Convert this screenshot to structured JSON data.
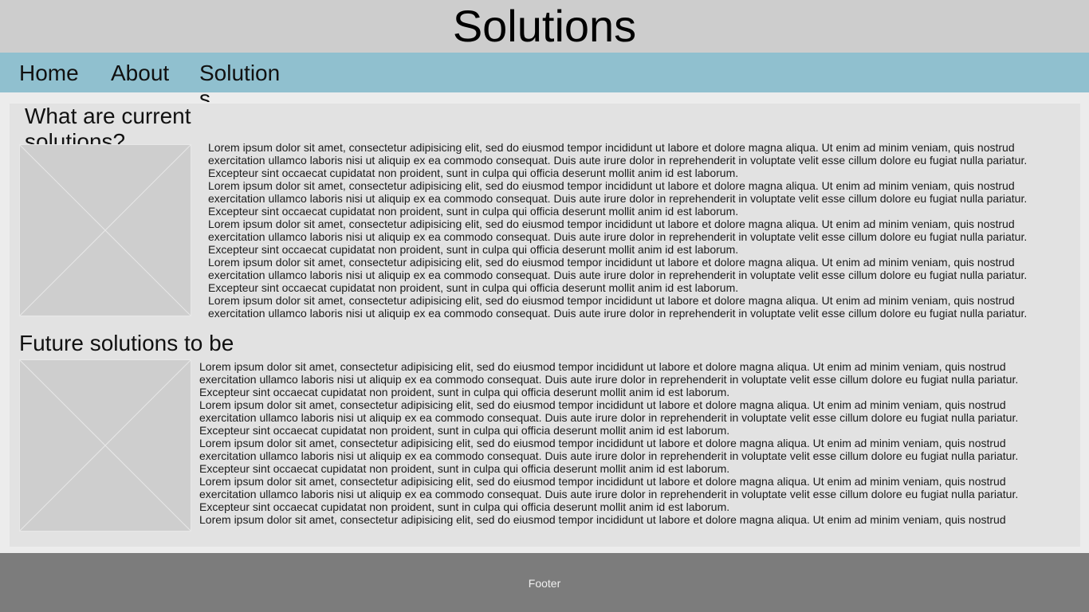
{
  "header": {
    "title": "Solutions"
  },
  "nav": {
    "items": [
      {
        "label": "Home"
      },
      {
        "label": "About"
      },
      {
        "label": "Solutions"
      }
    ]
  },
  "sections": [
    {
      "title": "What are current solutions?",
      "paragraphs": [
        "Lorem ipsum dolor sit amet, consectetur adipisicing elit, sed do eiusmod tempor incididunt ut labore et dolore magna aliqua. Ut enim ad minim veniam, quis nostrud exercitation ullamco laboris nisi ut aliquip ex ea commodo consequat. Duis aute irure dolor in reprehenderit in voluptate velit esse cillum dolore eu fugiat nulla pariatur. Excepteur sint occaecat cupidatat non proident, sunt in culpa qui officia deserunt mollit anim id est laborum.",
        "Lorem ipsum dolor sit amet, consectetur adipisicing elit, sed do eiusmod tempor incididunt ut labore et dolore magna aliqua. Ut enim ad minim veniam, quis nostrud exercitation ullamco laboris nisi ut aliquip ex ea commodo consequat. Duis aute irure dolor in reprehenderit in voluptate velit esse cillum dolore eu fugiat nulla pariatur. Excepteur sint occaecat cupidatat non proident, sunt in culpa qui officia deserunt mollit anim id est laborum.",
        "Lorem ipsum dolor sit amet, consectetur adipisicing elit, sed do eiusmod tempor incididunt ut labore et dolore magna aliqua. Ut enim ad minim veniam, quis nostrud exercitation ullamco laboris nisi ut aliquip ex ea commodo consequat. Duis aute irure dolor in reprehenderit in voluptate velit esse cillum dolore eu fugiat nulla pariatur. Excepteur sint occaecat cupidatat non proident, sunt in culpa qui officia deserunt mollit anim id est laborum.",
        "Lorem ipsum dolor sit amet, consectetur adipisicing elit, sed do eiusmod tempor incididunt ut labore et dolore magna aliqua. Ut enim ad minim veniam, quis nostrud exercitation ullamco laboris nisi ut aliquip ex ea commodo consequat. Duis aute irure dolor in reprehenderit in voluptate velit esse cillum dolore eu fugiat nulla pariatur. Excepteur sint occaecat cupidatat non proident, sunt in culpa qui officia deserunt mollit anim id est laborum.",
        "Lorem ipsum dolor sit amet, consectetur adipisicing elit, sed do eiusmod tempor incididunt ut labore et dolore magna aliqua. Ut enim ad minim veniam, quis nostrud exercitation ullamco laboris nisi ut aliquip ex ea commodo consequat. Duis aute irure dolor in reprehenderit in voluptate velit esse cillum dolore eu fugiat nulla pariatur. Excepteur sint"
      ]
    },
    {
      "title": "Future solutions to be",
      "paragraphs": [
        "Lorem ipsum dolor sit amet, consectetur adipisicing elit, sed do eiusmod tempor incididunt ut labore et dolore magna aliqua. Ut enim ad minim veniam, quis nostrud exercitation ullamco laboris nisi ut aliquip ex ea commodo consequat. Duis aute irure dolor in reprehenderit in voluptate velit esse cillum dolore eu fugiat nulla pariatur. Excepteur sint occaecat cupidatat non proident, sunt in culpa qui officia deserunt mollit anim id est laborum.",
        "Lorem ipsum dolor sit amet, consectetur adipisicing elit, sed do eiusmod tempor incididunt ut labore et dolore magna aliqua. Ut enim ad minim veniam, quis nostrud exercitation ullamco laboris nisi ut aliquip ex ea commodo consequat. Duis aute irure dolor in reprehenderit in voluptate velit esse cillum dolore eu fugiat nulla pariatur. Excepteur sint occaecat cupidatat non proident, sunt in culpa qui officia deserunt mollit anim id est laborum.",
        "Lorem ipsum dolor sit amet, consectetur adipisicing elit, sed do eiusmod tempor incididunt ut labore et dolore magna aliqua. Ut enim ad minim veniam, quis nostrud exercitation ullamco laboris nisi ut aliquip ex ea commodo consequat. Duis aute irure dolor in reprehenderit in voluptate velit esse cillum dolore eu fugiat nulla pariatur. Excepteur sint occaecat cupidatat non proident, sunt in culpa qui officia deserunt mollit anim id est laborum.",
        "Lorem ipsum dolor sit amet, consectetur adipisicing elit, sed do eiusmod tempor incididunt ut labore et dolore magna aliqua. Ut enim ad minim veniam, quis nostrud exercitation ullamco laboris nisi ut aliquip ex ea commodo consequat. Duis aute irure dolor in reprehenderit in voluptate velit esse cillum dolore eu fugiat nulla pariatur. Excepteur sint occaecat cupidatat non proident, sunt in culpa qui officia deserunt mollit anim id est laborum.",
        "Lorem ipsum dolor sit amet, consectetur adipisicing elit, sed do eiusmod tempor incididunt ut labore et dolore magna aliqua. Ut enim ad minim veniam, quis nostrud exercitation"
      ]
    }
  ],
  "footer": {
    "text": "Footer"
  },
  "colors": {
    "header_bg": "#cdcdcd",
    "nav_bg": "#90c0cf",
    "main_bg": "#e2e2e2",
    "footer_bg": "#7c7c7c"
  }
}
